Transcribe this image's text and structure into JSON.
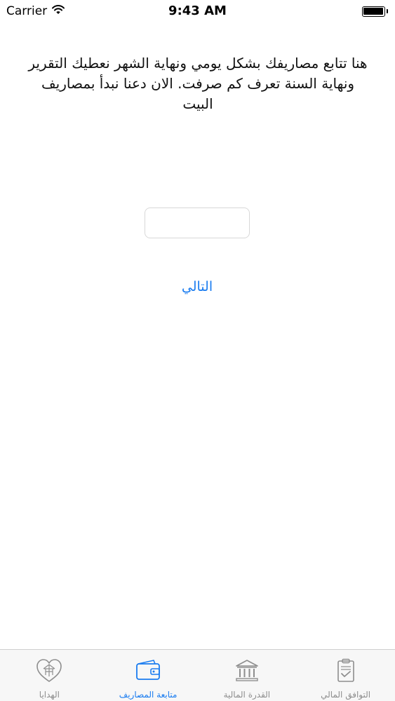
{
  "status_bar": {
    "carrier": "Carrier",
    "time": "9:43 AM"
  },
  "intro_text": "هنا تتابع مصاريفك بشكل يومي ونهاية الشهر نعطيك التقرير ونهاية السنة تعرف كم صرفت. الان دعنا نبدأ بمصاريف البيت",
  "amount_input": {
    "value": "",
    "placeholder": ""
  },
  "next_button_label": "التالي",
  "tab_bar": {
    "active_color": "#1a7cf0",
    "inactive_color": "#8e8e8e",
    "tabs": [
      {
        "label": "الهدايا",
        "icon": "gift-heart-icon",
        "active": false
      },
      {
        "label": "متابعة المصاريف",
        "icon": "wallet-icon",
        "active": true
      },
      {
        "label": "القدرة المالية",
        "icon": "bank-icon",
        "active": false
      },
      {
        "label": "التوافق المالي",
        "icon": "clipboard-check-icon",
        "active": false
      }
    ]
  }
}
